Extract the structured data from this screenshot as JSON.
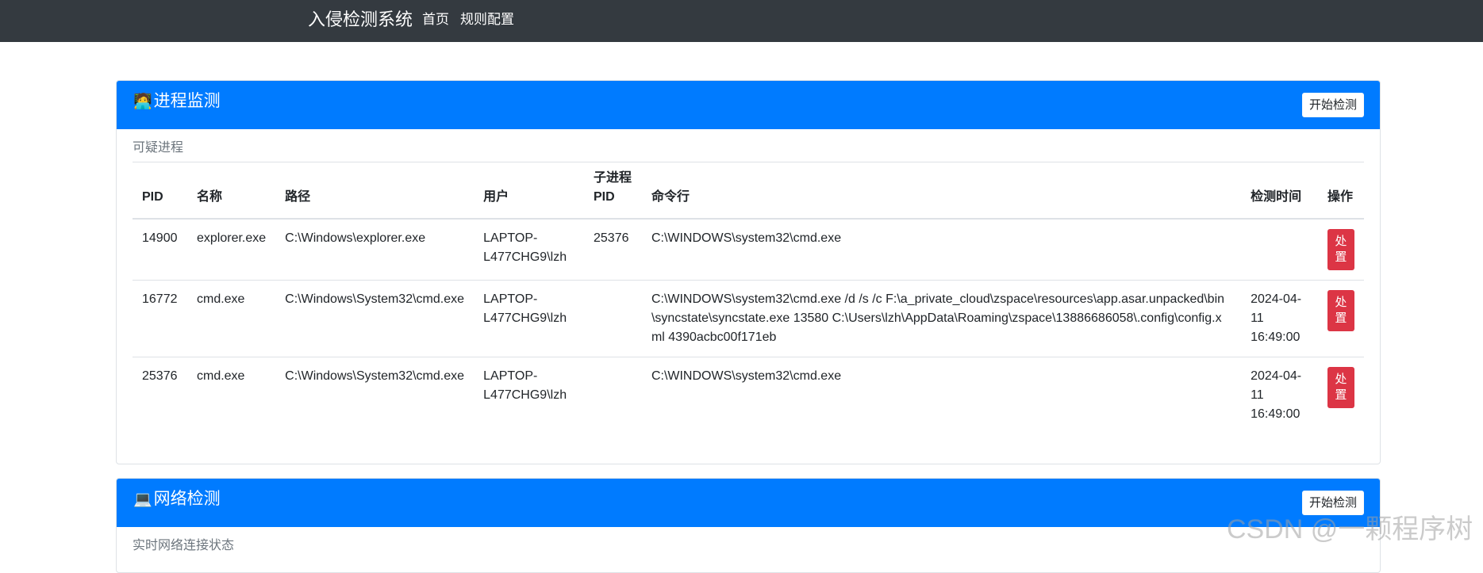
{
  "navbar": {
    "brand": "入侵检测系统",
    "links": [
      "首页",
      "规则配置"
    ]
  },
  "process_card": {
    "icon": "technologist-emoji",
    "icon_glyph": "🧑‍💻",
    "title": "进程监测",
    "start_button": "开始检测",
    "subtitle": "可疑进程",
    "columns": [
      "PID",
      "名称",
      "路径",
      "用户",
      "子进程PID",
      "命令行",
      "检测时间",
      "操作"
    ],
    "rows": [
      {
        "pid": "14900",
        "name": "explorer.exe",
        "path": "C:\\Windows\\explorer.exe",
        "user": "LAPTOP-L477CHG9\\lzh",
        "child_pid": "25376",
        "cmdline": "C:\\WINDOWS\\system32\\cmd.exe",
        "time": "",
        "action": "处置"
      },
      {
        "pid": "16772",
        "name": "cmd.exe",
        "path": "C:\\Windows\\System32\\cmd.exe",
        "user": "LAPTOP-L477CHG9\\lzh",
        "child_pid": "",
        "cmdline": "C:\\WINDOWS\\system32\\cmd.exe /d /s /c F:\\a_private_cloud\\zspace\\resources\\app.asar.unpacked\\bin\\syncstate\\syncstate.exe 13580 C:\\Users\\lzh\\AppData\\Roaming\\zspace\\13886686058\\.config\\config.xml 4390acbc00f171eb",
        "time": "2024-04-11 16:49:00",
        "action": "处置"
      },
      {
        "pid": "25376",
        "name": "cmd.exe",
        "path": "C:\\Windows\\System32\\cmd.exe",
        "user": "LAPTOP-L477CHG9\\lzh",
        "child_pid": "",
        "cmdline": "C:\\WINDOWS\\system32\\cmd.exe",
        "time": "2024-04-11 16:49:00",
        "action": "处置"
      }
    ]
  },
  "network_card": {
    "icon": "laptop-emoji",
    "icon_glyph": "💻",
    "title": "网络检测",
    "start_button": "开始检测",
    "subtitle": "实时网络连接状态"
  },
  "watermark": "CSDN @一颗程序树",
  "colors": {
    "navbar_bg": "#343a40",
    "primary": "#007bff",
    "danger": "#dc3545",
    "muted": "#6c757d"
  }
}
